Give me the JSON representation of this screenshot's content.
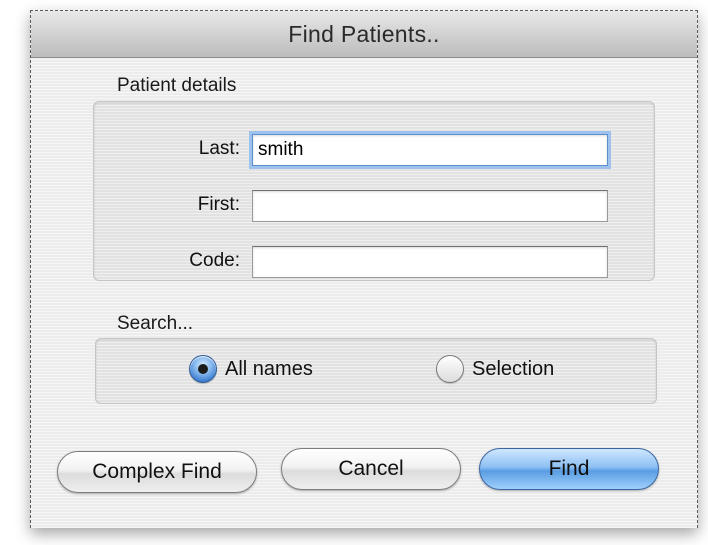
{
  "window": {
    "title": "Find Patients.."
  },
  "patient_details": {
    "label": "Patient details",
    "last_label": "Last:",
    "last_value": "smith",
    "first_label": "First:",
    "first_value": "",
    "code_label": "Code:",
    "code_value": ""
  },
  "search": {
    "label": "Search...",
    "options": [
      {
        "label": "All names",
        "checked": true
      },
      {
        "label": "Selection",
        "checked": false
      }
    ]
  },
  "buttons": {
    "complex_find": "Complex Find",
    "cancel": "Cancel",
    "find": "Find"
  },
  "colors": {
    "default_button": "#5a9de3",
    "focus_ring": "#9ec2ee",
    "window_bg": "#ececec"
  }
}
